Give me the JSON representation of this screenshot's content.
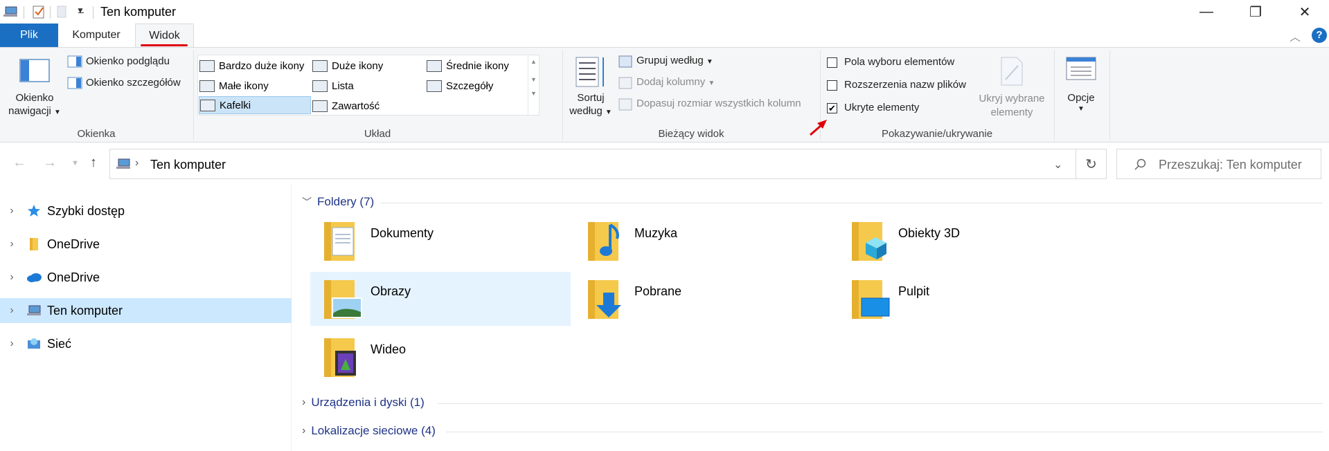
{
  "window": {
    "title": "Ten komputer",
    "controls": {
      "minimize": "—",
      "maximize": "❐",
      "close": "✕"
    }
  },
  "ribbon_tabs": [
    {
      "label": "Plik"
    },
    {
      "label": "Komputer"
    },
    {
      "label": "Widok"
    }
  ],
  "ribbon": {
    "okienka": {
      "nav_pane": "Okienko",
      "nav_pane2": "nawigacji",
      "preview_pane": "Okienko podglądu",
      "details_pane": "Okienko szczegółów",
      "group_label": "Okienka"
    },
    "uklad": {
      "items": [
        "Bardzo duże ikony",
        "Duże ikony",
        "Średnie ikony",
        "Małe ikony",
        "Lista",
        "Szczegóły",
        "Kafelki",
        "Zawartość"
      ],
      "selected": "Kafelki",
      "group_label": "Układ"
    },
    "biezacy_widok": {
      "sort1": "Sortuj",
      "sort2": "według",
      "group_by": "Grupuj według",
      "add_columns": "Dodaj kolumny",
      "fit_columns": "Dopasuj rozmiar wszystkich kolumn",
      "group_label": "Bieżący widok"
    },
    "pokazywanie": {
      "item_checkboxes": "Pola wyboru elementów",
      "item_checkboxes_checked": false,
      "file_extensions": "Rozszerzenia nazw plików",
      "file_extensions_checked": false,
      "hidden_items": "Ukryte elementy",
      "hidden_items_checked": true,
      "hide_selected1": "Ukryj wybrane",
      "hide_selected2": "elementy",
      "group_label": "Pokazywanie/ukrywanie"
    },
    "opcje": {
      "label": "Opcje"
    }
  },
  "address": {
    "path": "Ten komputer",
    "search_placeholder": "Przeszukaj: Ten komputer"
  },
  "sidebar": {
    "items": [
      {
        "label": "Szybki dostęp",
        "icon": "star-icon"
      },
      {
        "label": "OneDrive",
        "icon": "folder-icon"
      },
      {
        "label": "OneDrive",
        "icon": "cloud-icon"
      },
      {
        "label": "Ten komputer",
        "icon": "computer-icon",
        "selected": true
      },
      {
        "label": "Sieć",
        "icon": "network-icon"
      }
    ]
  },
  "content": {
    "sections": [
      {
        "header": "Foldery (7)",
        "expanded": true
      },
      {
        "header": "Urządzenia i dyski (1)",
        "expanded": false
      },
      {
        "header": "Lokalizacje sieciowe (4)",
        "expanded": false
      }
    ],
    "folders": [
      {
        "name": "Dokumenty",
        "icon": "documents-folder-icon"
      },
      {
        "name": "Muzyka",
        "icon": "music-folder-icon"
      },
      {
        "name": "Obiekty 3D",
        "icon": "3d-objects-folder-icon"
      },
      {
        "name": "Obrazy",
        "icon": "pictures-folder-icon",
        "selected": true
      },
      {
        "name": "Pobrane",
        "icon": "downloads-folder-icon"
      },
      {
        "name": "Pulpit",
        "icon": "desktop-folder-icon"
      },
      {
        "name": "Wideo",
        "icon": "videos-folder-icon"
      }
    ]
  },
  "colors": {
    "accent": "#1a6fc2",
    "selection": "#cce8ff",
    "section_header": "#1e3287",
    "annotation": "#e0000b"
  }
}
